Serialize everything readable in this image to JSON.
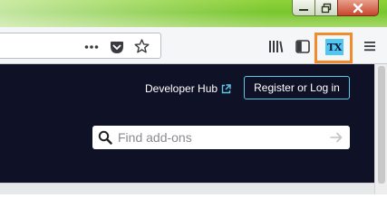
{
  "window": {
    "controls": {
      "minimize_icon": "minimize-icon",
      "maximize_icon": "restore-icon",
      "close_icon": "close-icon"
    }
  },
  "toolbar": {
    "page_actions_icon": "ellipsis-icon",
    "pocket_icon": "pocket-icon",
    "bookmark_icon": "star-icon",
    "library_icon": "library-icon",
    "sidebar_icon": "sidebar-icon",
    "extension_label": "TX",
    "menu_icon": "hamburger-menu-icon",
    "highlight_color": "#f08c2b"
  },
  "header": {
    "developer_hub_label": "Developer Hub",
    "register_label": "Register or Log in",
    "accent_color": "#5cc8e8"
  },
  "search": {
    "placeholder": "Find add-ons",
    "value": ""
  },
  "colors": {
    "page_background": "#0f1126",
    "titlebar_green": "#79c62e"
  }
}
